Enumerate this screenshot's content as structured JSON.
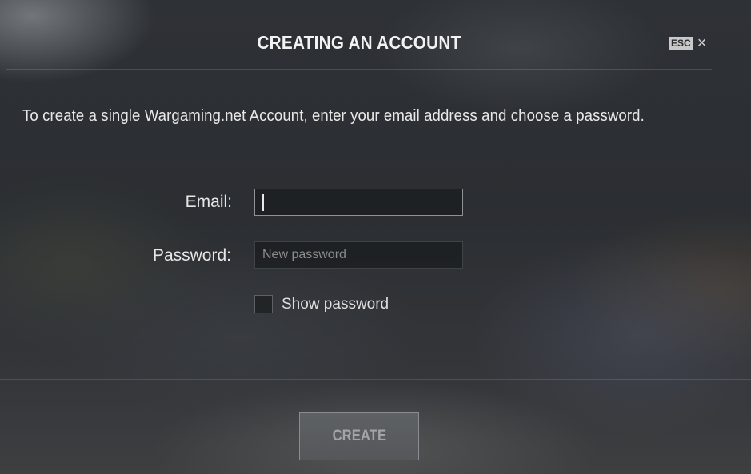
{
  "dialog": {
    "title": "CREATING AN ACCOUNT",
    "esc_label": "ESC",
    "close_glyph": "×",
    "intro": "To create a single Wargaming.net Account, enter your email address and choose a password."
  },
  "form": {
    "email_label": "Email:",
    "email_value": "",
    "password_label": "Password:",
    "password_placeholder": "New password",
    "password_value": "",
    "show_password_label": "Show password",
    "show_password_checked": false
  },
  "footer": {
    "create_label": "CREATE"
  },
  "icons": {
    "close": "close-icon",
    "checkbox": "checkbox-icon"
  }
}
